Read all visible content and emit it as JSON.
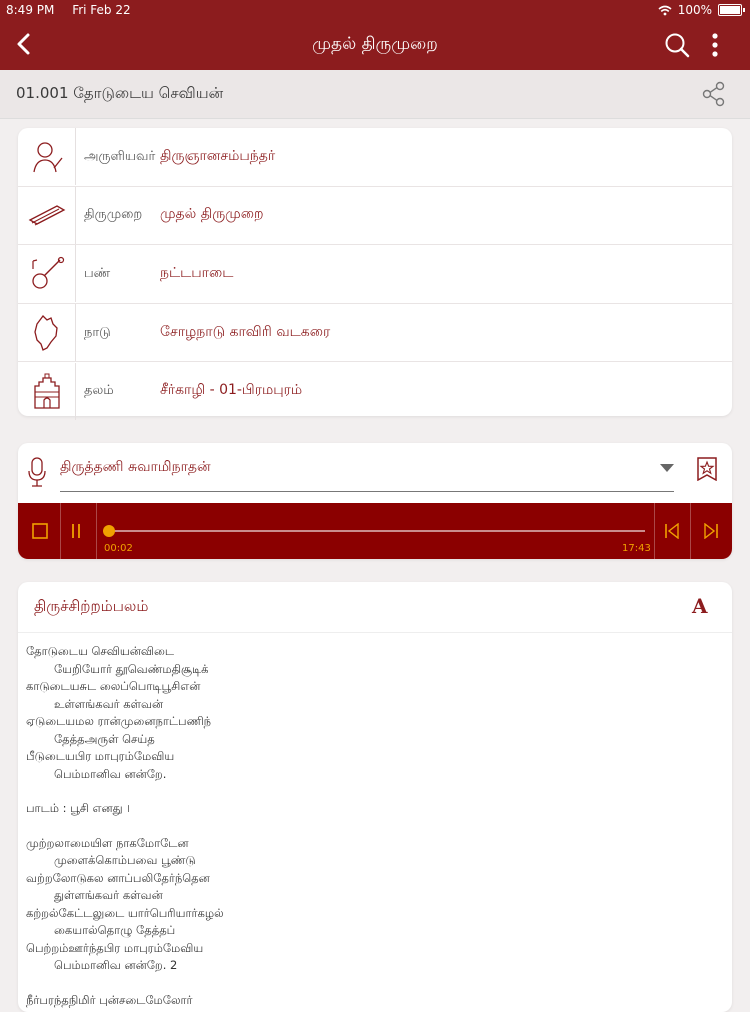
{
  "status": {
    "time": "8:49 PM",
    "date": "Fri Feb 22",
    "battery": "100%"
  },
  "nav": {
    "title": "முதல் திருமுறை"
  },
  "subheader": {
    "label": "01.001 தோடுடைய செவியன்"
  },
  "info": [
    {
      "key": "அருளியவர்",
      "value": "திருஞானசம்பந்தர்",
      "icon": "saint-icon"
    },
    {
      "key": "திருமுறை",
      "value": "முதல் திருமுறை",
      "icon": "palm-leaf-icon"
    },
    {
      "key": "பண்",
      "value": "நட்டபாடை",
      "icon": "veena-icon"
    },
    {
      "key": "நாடு",
      "value": "சோழநாடு காவிரி வடகரை",
      "icon": "map-icon"
    },
    {
      "key": "தலம்",
      "value": "சீர்காழி - 01-பிரமபுரம்",
      "icon": "temple-icon"
    }
  ],
  "audio": {
    "singer": "திருத்தணி சுவாமிநாதன்",
    "elapsed": "00:02",
    "duration": "17:43",
    "progress": 0.002
  },
  "lyrics": {
    "title": "திருச்சிற்றம்பலம்",
    "font_button": "A",
    "lines": [
      {
        "text": "தோடுடைய செவியன்விடை",
        "indent": false
      },
      {
        "text": "யேறியோர் தூவெண்மதிசூடிக்",
        "indent": true
      },
      {
        "text": "காடுடையசுட லைப்பொடிபூசிஎன்",
        "indent": false
      },
      {
        "text": "உள்ளங்கவர் கள்வன்",
        "indent": true
      },
      {
        "text": "ஏடுடையமல ரான்முனைநாட்பணிந்",
        "indent": false
      },
      {
        "text": "தேத்தஅருள் செய்த",
        "indent": true
      },
      {
        "text": "பீடுடையபிர மாபுரம்மேவிய",
        "indent": false
      },
      {
        "text": "பெம்மானிவ னன்றே.",
        "indent": true
      },
      {
        "text": "",
        "indent": false
      },
      {
        "text": "பாடம் : பூசி எனது ।",
        "indent": false
      },
      {
        "text": "",
        "indent": false
      },
      {
        "text": "முற்றலாமையிள நாகமோடேன",
        "indent": false
      },
      {
        "text": "முளைக்கொம்பவை பூண்டு",
        "indent": true
      },
      {
        "text": "வற்றலோடுகல னாப்பலிதேர்ந்தென",
        "indent": false
      },
      {
        "text": "துள்ளங்கவர் கள்வன்",
        "indent": true
      },
      {
        "text": "கற்றல்கேட்டலுடை யார்பெரியார்கழல்",
        "indent": false
      },
      {
        "text": "கையால்தொழு தேத்தப்",
        "indent": true
      },
      {
        "text": "பெற்றம்ஊர்ந்தபிர மாபுரம்மேவிய",
        "indent": false
      },
      {
        "text": "பெம்மானிவ னன்றே. 2",
        "indent": true
      },
      {
        "text": "",
        "indent": false
      },
      {
        "text": "நீர்பரந்தநிமிர் புன்சடைமேலோர்",
        "indent": false
      }
    ]
  },
  "colors": {
    "brand": "#8c1c1e",
    "player": "#8b0000",
    "accent": "#f0a100"
  }
}
